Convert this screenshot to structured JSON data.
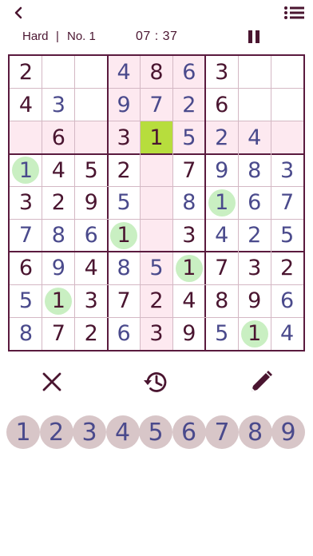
{
  "header": {
    "back_icon": "chevron-left-icon",
    "menu_icon": "list-icon"
  },
  "info": {
    "difficulty": "Hard",
    "separator": "|",
    "puzzle_number": "No. 1",
    "timer": "07 : 37",
    "pause_icon": "pause-icon"
  },
  "board": {
    "cells": [
      [
        "2",
        "",
        "",
        "4",
        "8",
        "6",
        "3",
        "",
        ""
      ],
      [
        "4",
        "3",
        "",
        "9",
        "7",
        "2",
        "6",
        "",
        ""
      ],
      [
        "",
        "6",
        "",
        "3",
        "1",
        "5",
        "2",
        "4",
        ""
      ],
      [
        "1",
        "4",
        "5",
        "2",
        "",
        "7",
        "9",
        "8",
        "3"
      ],
      [
        "3",
        "2",
        "9",
        "5",
        "",
        "8",
        "1",
        "6",
        "7"
      ],
      [
        "7",
        "8",
        "6",
        "1",
        "",
        "3",
        "4",
        "2",
        "5"
      ],
      [
        "6",
        "9",
        "4",
        "8",
        "5",
        "1",
        "7",
        "3",
        "2"
      ],
      [
        "5",
        "1",
        "3",
        "7",
        "2",
        "4",
        "8",
        "9",
        "6"
      ],
      [
        "8",
        "7",
        "2",
        "6",
        "3",
        "9",
        "5",
        "1",
        "4"
      ]
    ],
    "entered": [
      [
        0,
        0,
        0,
        1,
        0,
        1,
        0,
        0,
        0
      ],
      [
        0,
        1,
        0,
        1,
        1,
        1,
        0,
        0,
        0
      ],
      [
        0,
        0,
        0,
        0,
        0,
        1,
        1,
        1,
        0
      ],
      [
        1,
        0,
        0,
        0,
        0,
        0,
        1,
        1,
        1
      ],
      [
        0,
        0,
        0,
        1,
        0,
        1,
        1,
        1,
        1
      ],
      [
        1,
        1,
        1,
        0,
        0,
        0,
        1,
        1,
        1
      ],
      [
        0,
        1,
        0,
        1,
        1,
        0,
        0,
        0,
        0
      ],
      [
        1,
        0,
        0,
        0,
        0,
        0,
        0,
        0,
        1
      ],
      [
        1,
        0,
        0,
        1,
        0,
        0,
        1,
        0,
        1
      ]
    ],
    "selected_cell": {
      "row": 2,
      "col": 4
    },
    "highlighted_digit": "1",
    "colors": {
      "selected": "#b7dd3d",
      "highlight_band": "#fde9f0",
      "same_digit_mark": "#c9efc2",
      "given_digit": "#4a1530",
      "entered_digit": "#4a4a8c"
    }
  },
  "tools": {
    "erase_icon": "close-icon",
    "undo_icon": "history-icon",
    "notes_icon": "pencil-icon"
  },
  "numpad": [
    "1",
    "2",
    "3",
    "4",
    "5",
    "6",
    "7",
    "8",
    "9"
  ]
}
